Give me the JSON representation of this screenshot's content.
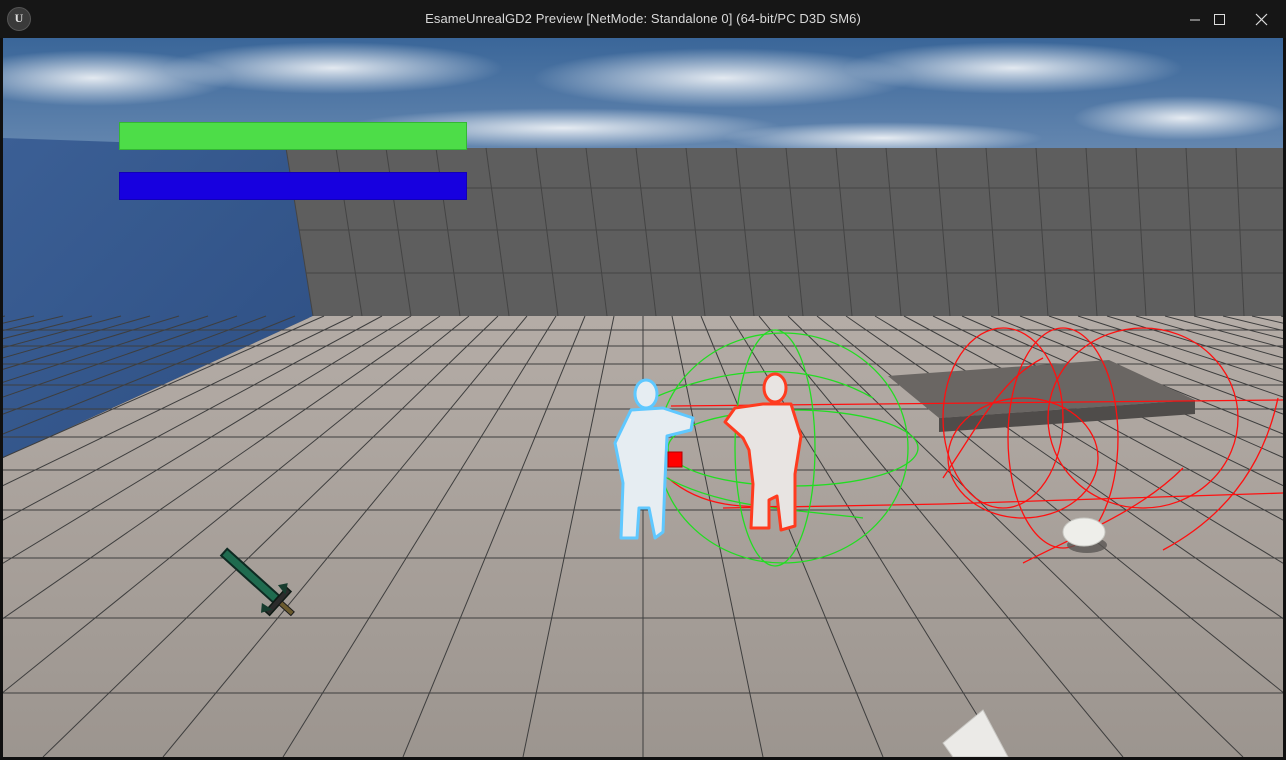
{
  "window": {
    "title": "EsameUnrealGD2 Preview [NetMode: Standalone 0]  (64-bit/PC D3D SM6)",
    "logo_icon": "unreal-engine-logo-icon",
    "controls": [
      "minimize-icon",
      "maximize-icon",
      "close-icon"
    ]
  },
  "hud": {
    "health": {
      "fraction": 1.0,
      "color": "#4ddd48"
    },
    "mana": {
      "fraction": 1.0,
      "color": "#1700df"
    }
  },
  "scene": {
    "colors": {
      "sky_top": "#3d6aa0",
      "sky_bottom": "#9fb5cc",
      "floor": "#a39c97",
      "wall": "#5c5c5c",
      "player_outline": "#5fc8ff",
      "enemy_outline": "#ff3b1f",
      "debug_sphere_green": "#22dd22",
      "debug_line_red": "#ff0000"
    },
    "icons": [
      "sword-pickup-icon",
      "player-mannequin",
      "enemy-mannequin",
      "egg-pickup",
      "platform-ramp",
      "debug-collision-sphere"
    ]
  }
}
